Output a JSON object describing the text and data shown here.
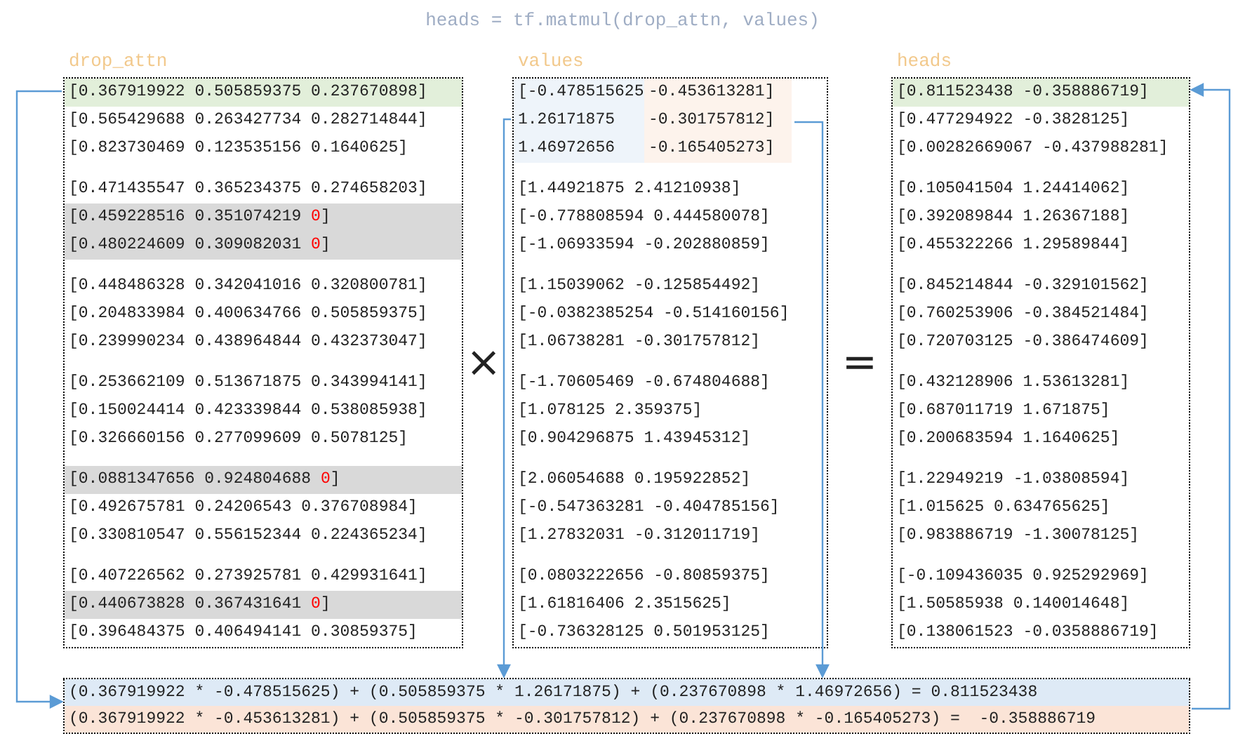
{
  "title": "heads = tf.matmul(drop_attn, values)",
  "operators": {
    "multiply": "×",
    "equals": "="
  },
  "drop_attn": {
    "label": "drop_attn",
    "groups": [
      [
        {
          "text": "[0.367919922 0.505859375 0.237670898]",
          "selected": true,
          "dropped": false
        },
        {
          "text": "[0.565429688 0.263427734 0.282714844]",
          "selected": false,
          "dropped": false
        },
        {
          "text": "[0.823730469 0.123535156 0.1640625]",
          "selected": false,
          "dropped": false
        }
      ],
      [
        {
          "text": "[0.471435547 0.365234375 0.274658203]",
          "selected": false,
          "dropped": false
        },
        {
          "text": "[0.459228516 0.351074219 ",
          "dropped_value": "0",
          "tail": "]",
          "selected": false,
          "dropped": true
        },
        {
          "text": "[0.480224609 0.309082031 ",
          "dropped_value": "0",
          "tail": "]",
          "selected": false,
          "dropped": true
        }
      ],
      [
        {
          "text": "[0.448486328 0.342041016 0.320800781]",
          "selected": false,
          "dropped": false
        },
        {
          "text": "[0.204833984 0.400634766 0.505859375]",
          "selected": false,
          "dropped": false
        },
        {
          "text": "[0.239990234 0.438964844 0.432373047]",
          "selected": false,
          "dropped": false
        }
      ],
      [
        {
          "text": "[0.253662109 0.513671875 0.343994141]",
          "selected": false,
          "dropped": false
        },
        {
          "text": "[0.150024414 0.423339844 0.538085938]",
          "selected": false,
          "dropped": false
        },
        {
          "text": "[0.326660156 0.277099609 0.5078125]",
          "selected": false,
          "dropped": false
        }
      ],
      [
        {
          "text": "[0.0881347656 0.924804688 ",
          "dropped_value": "0",
          "tail": "]",
          "selected": false,
          "dropped": true
        },
        {
          "text": "[0.492675781 0.24206543 0.376708984]",
          "selected": false,
          "dropped": false
        },
        {
          "text": "[0.330810547 0.556152344 0.224365234]",
          "selected": false,
          "dropped": false
        }
      ],
      [
        {
          "text": "[0.407226562 0.273925781 0.429931641]",
          "selected": false,
          "dropped": false
        },
        {
          "text": "[0.440673828 0.367431641 ",
          "dropped_value": "0",
          "tail": "]",
          "selected": false,
          "dropped": true
        },
        {
          "text": "[0.396484375 0.406494141 0.30859375]",
          "selected": false,
          "dropped": false
        }
      ]
    ]
  },
  "values": {
    "label": "values",
    "first_group": {
      "left": {
        "color": "#eef4fa",
        "cells": [
          "[-0.478515625",
          "1.26171875",
          "1.46972656"
        ]
      },
      "right": {
        "color": "#fdf3ec",
        "cells": [
          "-0.453613281]",
          "-0.301757812]",
          "-0.165405273]"
        ]
      }
    },
    "groups": [
      [
        "[1.44921875 2.41210938]",
        "[-0.778808594 0.444580078]",
        "[-1.06933594 -0.202880859]"
      ],
      [
        "[1.15039062 -0.125854492]",
        "[-0.0382385254 -0.514160156]",
        "[1.06738281 -0.301757812]"
      ],
      [
        "[-1.70605469 -0.674804688]",
        "[1.078125 2.359375]",
        "[0.904296875 1.43945312]"
      ],
      [
        "[2.06054688 0.195922852]",
        "[-0.547363281 -0.404785156]",
        "[1.27832031 -0.312011719]"
      ],
      [
        "[0.0803222656 -0.80859375]",
        "[1.61816406 2.3515625]",
        "[-0.736328125 0.501953125]"
      ]
    ]
  },
  "heads": {
    "label": "heads",
    "groups": [
      [
        {
          "text": "[0.811523438 -0.358886719]",
          "selected": true
        },
        {
          "text": "[0.477294922 -0.3828125]",
          "selected": false
        },
        {
          "text": "[0.00282669067 -0.437988281]",
          "selected": false
        }
      ],
      [
        {
          "text": "[0.105041504 1.24414062]",
          "selected": false
        },
        {
          "text": "[0.392089844 1.26367188]",
          "selected": false
        },
        {
          "text": "[0.455322266 1.29589844]",
          "selected": false
        }
      ],
      [
        {
          "text": "[0.845214844 -0.329101562]",
          "selected": false
        },
        {
          "text": "[0.760253906 -0.384521484]",
          "selected": false
        },
        {
          "text": "[0.720703125 -0.386474609]",
          "selected": false
        }
      ],
      [
        {
          "text": "[0.432128906 1.53613281]",
          "selected": false
        },
        {
          "text": "[0.687011719 1.671875]",
          "selected": false
        },
        {
          "text": "[0.200683594 1.1640625]",
          "selected": false
        }
      ],
      [
        {
          "text": "[1.22949219 -1.03808594]",
          "selected": false
        },
        {
          "text": "[1.015625 0.634765625]",
          "selected": false
        },
        {
          "text": "[0.983886719 -1.30078125]",
          "selected": false
        }
      ],
      [
        {
          "text": "[-0.109436035 0.925292969]",
          "selected": false
        },
        {
          "text": "[1.50585938 0.140014648]",
          "selected": false
        },
        {
          "text": "[0.138061523 -0.0358886719]",
          "selected": false
        }
      ]
    ]
  },
  "equations": [
    {
      "text": "(0.367919922 * -0.478515625) + (0.505859375 * 1.26171875) + (0.237670898 * 1.46972656) = 0.811523438",
      "color": "#deeaf6"
    },
    {
      "text": "(0.367919922 * -0.453613281) + (0.505859375 * -0.301757812) + (0.237670898 * -0.165405273) =  -0.358886719",
      "color": "#fbe4d7"
    }
  ]
}
